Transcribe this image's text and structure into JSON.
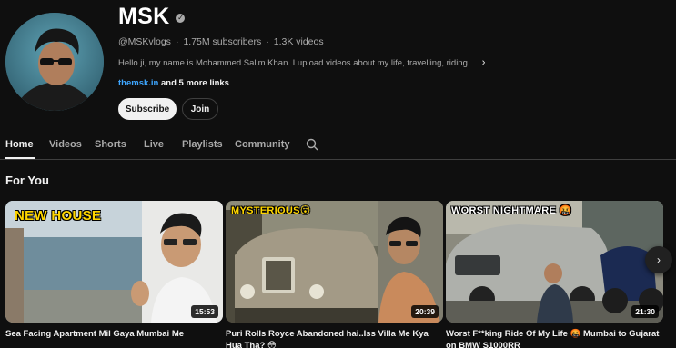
{
  "channel": {
    "name": "MSK",
    "handle": "@MSKvlogs",
    "subscribers": "1.75M subscribers",
    "videos": "1.3K videos",
    "separator": "·",
    "description": "Hello ji, my name is Mohammed Salim Khan. I upload videos about my life, travelling, riding...",
    "link": "themsk.in",
    "more_links": " and 5 more links",
    "verified_icon": "check-circle-icon"
  },
  "buttons": {
    "subscribe": "Subscribe",
    "join": "Join"
  },
  "tabs": [
    "Home",
    "Videos",
    "Shorts",
    "Live",
    "Playlists",
    "Community"
  ],
  "active_tab": "Home",
  "section": {
    "title": "For You"
  },
  "videos": [
    {
      "thumb_text": "NEW HOUSE",
      "duration": "15:53",
      "title": "Sea Facing Apartment Mil Gaya Mumbai Me"
    },
    {
      "thumb_text": "MYSTERIOUS😮",
      "duration": "20:39",
      "title": "Puri Rolls Royce Abandoned hai..Iss Villa Me Kya Hua Tha? 😳"
    },
    {
      "thumb_text": "WORST NIGHTMARE 🤬",
      "duration": "21:30",
      "title": "Worst F**king Ride Of My Life 🤬 Mumbai to Gujarat on BMW S1000RR"
    }
  ],
  "colors": {
    "background": "#0f0f0f",
    "text": "#f1f1f1",
    "secondary_text": "#aaaaaa",
    "link": "#3ea6ff",
    "thumb_text_yellow": "#ffd600"
  }
}
